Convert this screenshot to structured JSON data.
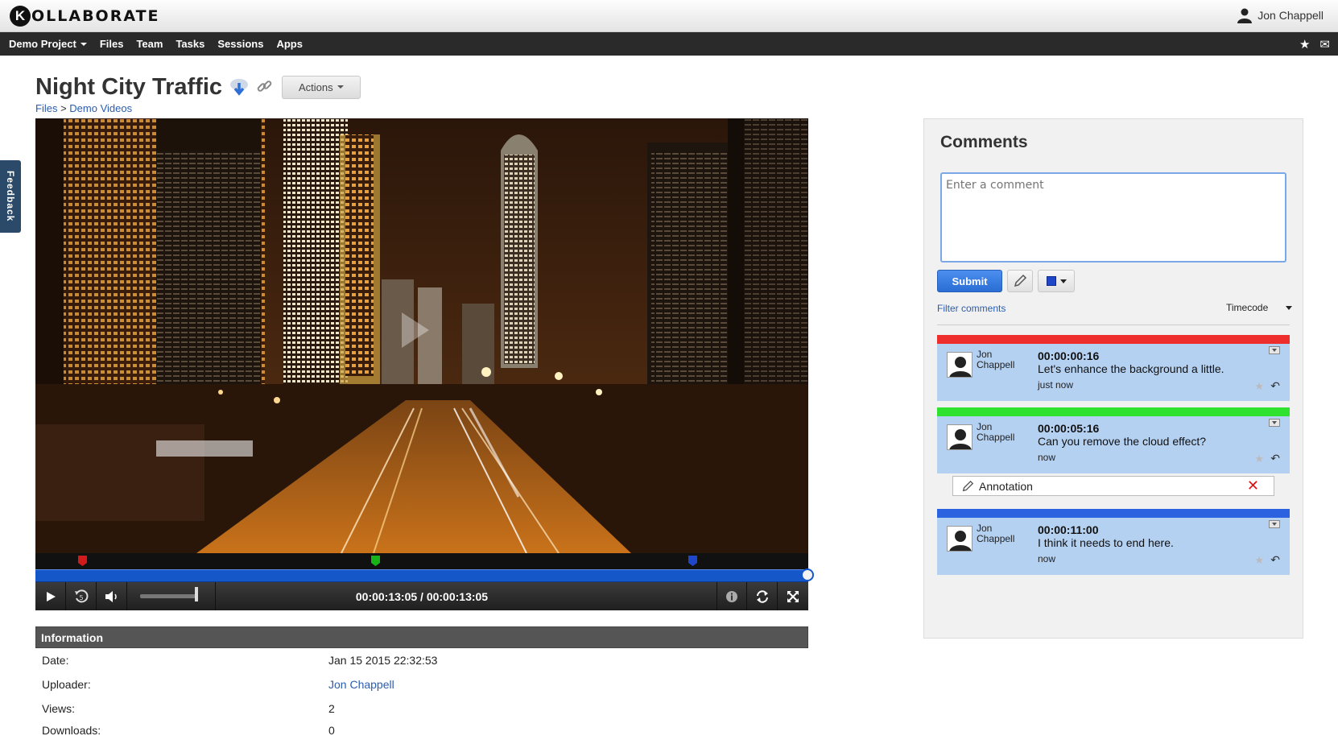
{
  "app": {
    "logo_letter": "K",
    "logo_text": "OLLABORATE",
    "user_name": "Jon Chappell"
  },
  "nav": {
    "project": "Demo Project",
    "items": [
      "Files",
      "Team",
      "Tasks",
      "Sessions",
      "Apps"
    ],
    "icons": [
      "star-icon",
      "mail-icon"
    ]
  },
  "feedback_label": "Feedback",
  "page": {
    "title": "Night City Traffic",
    "actions_label": "Actions",
    "breadcrumb": {
      "root": "Files",
      "sep": " > ",
      "leaf": "Demo Videos"
    }
  },
  "player": {
    "timecode": "00:00:13:05 / 00:00:13:05",
    "progress": 1.0,
    "volume": 1.0,
    "markers": [
      {
        "time_fraction": 0.06,
        "color": "#d11a1a"
      },
      {
        "time_fraction": 0.44,
        "color": "#18b318"
      },
      {
        "time_fraction": 0.85,
        "color": "#1f46c8"
      }
    ]
  },
  "info": {
    "header": "Information",
    "rows": [
      {
        "label": "Date:",
        "value": "Jan 15 2015 22:32:53"
      },
      {
        "label": "Uploader:",
        "value": "Jon Chappell"
      },
      {
        "label": "Views:",
        "value": "2"
      },
      {
        "label": "Downloads:",
        "value": "0"
      }
    ]
  },
  "comments": {
    "title": "Comments",
    "placeholder": "Enter a comment",
    "submit_label": "Submit",
    "filter_label": "Filter comments",
    "sort_label": "Timecode",
    "annotation_label": "Annotation",
    "items": [
      {
        "author_first": "Jon",
        "author_last": "Chappell",
        "timecode": "00:00:00:16",
        "text": "Let's enhance the background a little.",
        "when": "just now",
        "color": "#ee2d2d"
      },
      {
        "author_first": "Jon",
        "author_last": "Chappell",
        "timecode": "00:00:05:16",
        "text": "Can you remove the cloud effect?",
        "when": "now",
        "color": "#2fe22f"
      },
      {
        "author_first": "Jon",
        "author_last": "Chappell",
        "timecode": "00:00:11:00",
        "text": "I think it needs to end here.",
        "when": "now",
        "color": "#2b62e0"
      }
    ]
  }
}
